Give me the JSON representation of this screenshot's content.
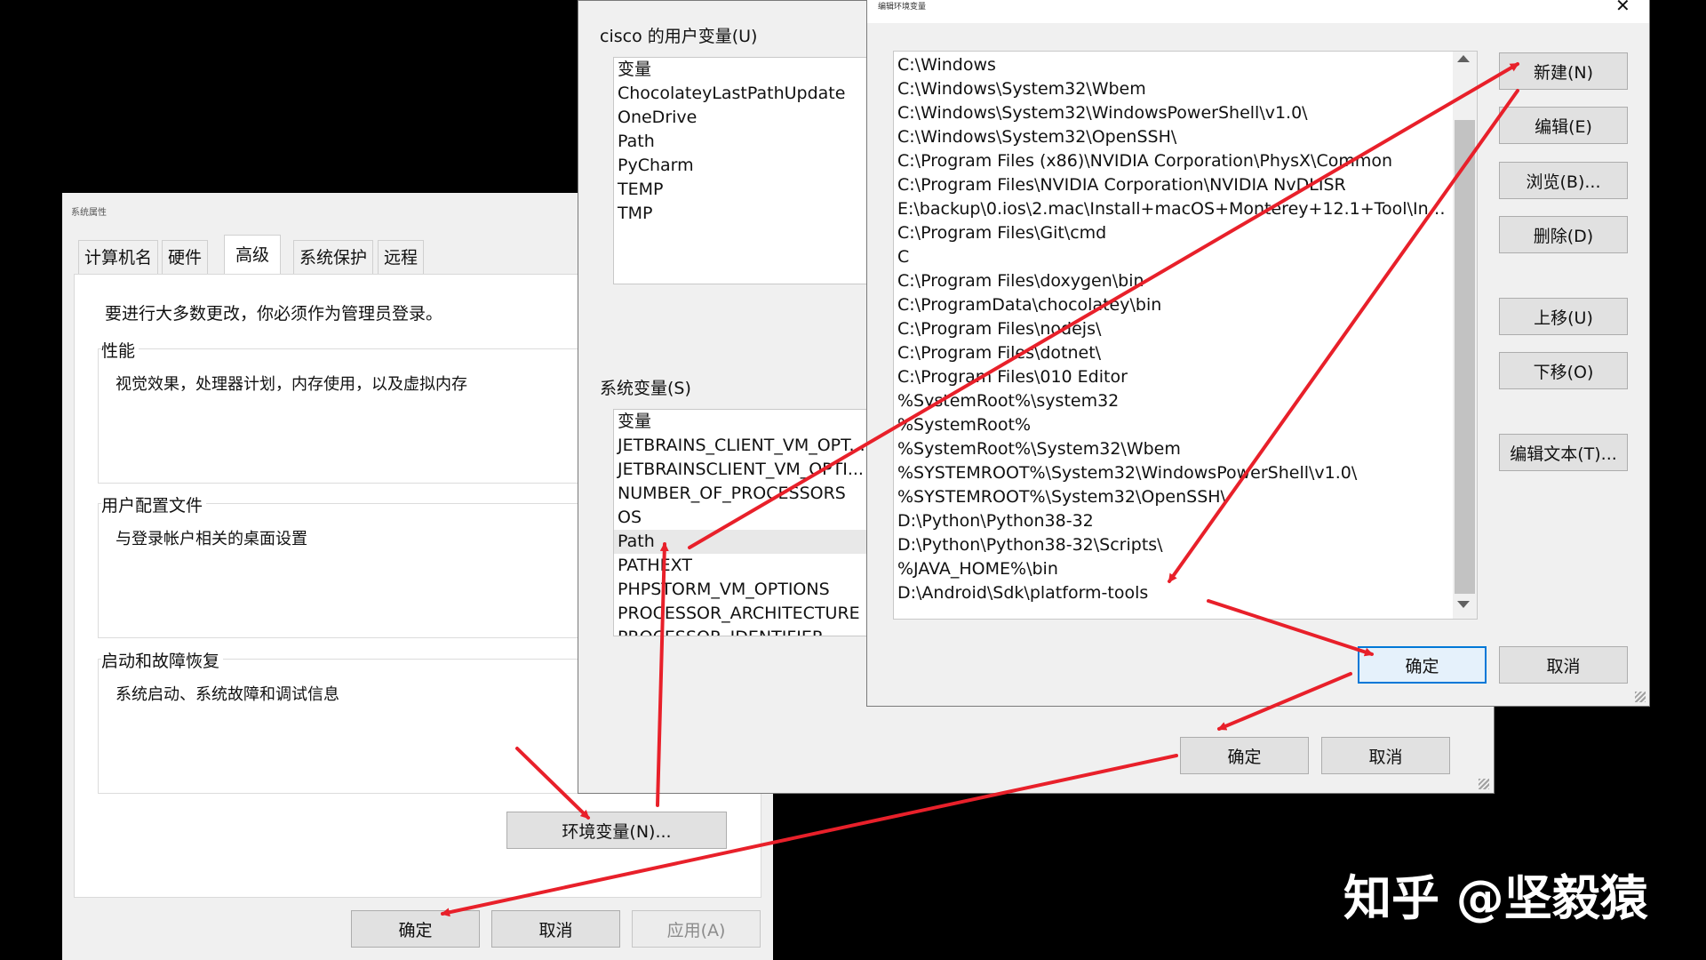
{
  "sys_props": {
    "title": "系统属性",
    "tabs": [
      "计算机名",
      "硬件",
      "高级",
      "系统保护",
      "远程"
    ],
    "admin_notice": "要进行大多数更改，你必须作为管理员登录。",
    "performance": {
      "title": "性能",
      "desc": "视觉效果，处理器计划，内存使用，以及虚拟内存"
    },
    "user_profile": {
      "title": "用户配置文件",
      "desc": "与登录帐户相关的桌面设置"
    },
    "startup": {
      "title": "启动和故障恢复",
      "desc": "系统启动、系统故障和调试信息"
    },
    "env_button": "环境变量(N)...",
    "ok": "确定",
    "cancel": "取消",
    "apply": "应用(A)"
  },
  "env_vars": {
    "user_section": "cisco 的用户变量(U)",
    "user_header": "变量",
    "user_vars": [
      "ChocolateyLastPathUpdate",
      "OneDrive",
      "Path",
      "PyCharm",
      "TEMP",
      "TMP"
    ],
    "system_section": "系统变量(S)",
    "system_header": "变量",
    "system_vars": [
      "JETBRAINS_CLIENT_VM_OPT...",
      "JETBRAINSCLIENT_VM_OPTI...",
      "NUMBER_OF_PROCESSORS",
      "OS",
      "Path",
      "PATHEXT",
      "PHPSTORM_VM_OPTIONS",
      "PROCESSOR_ARCHITECTURE",
      "PROCESSOR_IDENTIFIER"
    ],
    "ok": "确定",
    "cancel": "取消"
  },
  "edit_env": {
    "title": "编辑环境变量",
    "paths": [
      "C:\\Windows",
      "C:\\Windows\\System32\\Wbem",
      "C:\\Windows\\System32\\WindowsPowerShell\\v1.0\\",
      "C:\\Windows\\System32\\OpenSSH\\",
      "C:\\Program Files (x86)\\NVIDIA Corporation\\PhysX\\Common",
      "C:\\Program Files\\NVIDIA Corporation\\NVIDIA NvDLISR",
      "E:\\backup\\0.ios\\2.mac\\Install+macOS+Monterey+12.1+Tool\\Inns...",
      "C:\\Program Files\\Git\\cmd",
      "C",
      "C:\\Program Files\\doxygen\\bin",
      "C:\\ProgramData\\chocolatey\\bin",
      "C:\\Program Files\\nodejs\\",
      "C:\\Program Files\\dotnet\\",
      "C:\\Program Files\\010 Editor",
      "%SystemRoot%\\system32",
      "%SystemRoot%",
      "%SystemRoot%\\System32\\Wbem",
      "%SYSTEMROOT%\\System32\\WindowsPowerShell\\v1.0\\",
      "%SYSTEMROOT%\\System32\\OpenSSH\\",
      "D:\\Python\\Python38-32",
      "D:\\Python\\Python38-32\\Scripts\\",
      "%JAVA_HOME%\\bin",
      "D:\\Android\\Sdk\\platform-tools"
    ],
    "new": "新建(N)",
    "edit": "编辑(E)",
    "browse": "浏览(B)...",
    "delete": "删除(D)",
    "move_up": "上移(U)",
    "move_down": "下移(O)",
    "edit_text": "编辑文本(T)...",
    "ok": "确定",
    "cancel": "取消",
    "close_glyph": "✕"
  },
  "watermark": "知乎 @坚毅猿",
  "colors": {
    "arrow": "#e8202a",
    "accent": "#0078d7"
  }
}
